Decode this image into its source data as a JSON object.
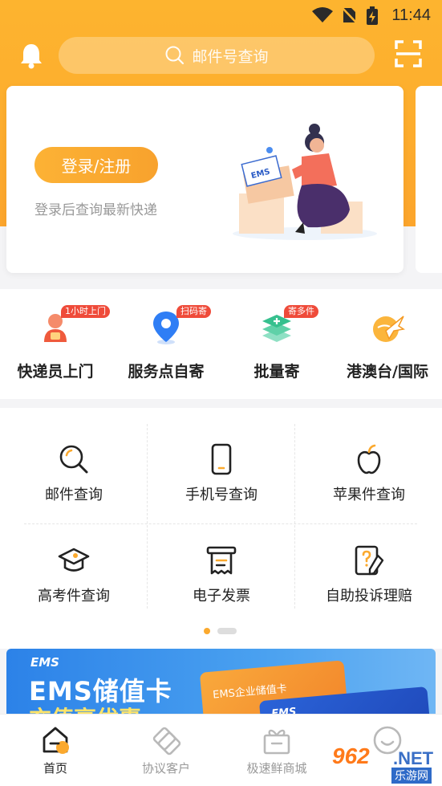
{
  "status_bar": {
    "time": "11:44"
  },
  "header": {
    "search_placeholder": "邮件号查询"
  },
  "login_card": {
    "button_label": "登录/注册",
    "hint": "登录后查询最新快递",
    "illustration_text": "EMS"
  },
  "services": [
    {
      "label": "快递员上门",
      "tag": "1小时上门",
      "icon": "courier-icon"
    },
    {
      "label": "服务点自寄",
      "tag": "扫码寄",
      "icon": "location-pin-icon"
    },
    {
      "label": "批量寄",
      "tag": "寄多件",
      "icon": "layers-icon"
    },
    {
      "label": "港澳台/国际",
      "tag": "",
      "icon": "plane-globe-icon"
    }
  ],
  "query_grid": [
    {
      "label": "邮件查询",
      "icon": "magnifier-icon"
    },
    {
      "label": "手机号查询",
      "icon": "phone-icon"
    },
    {
      "label": "苹果件查询",
      "icon": "apple-icon"
    },
    {
      "label": "高考件查询",
      "icon": "graduation-cap-icon"
    },
    {
      "label": "电子发票",
      "icon": "invoice-icon"
    },
    {
      "label": "自助投诉理赔",
      "icon": "complaint-icon"
    }
  ],
  "banner": {
    "brand": "EMS",
    "title": "EMS储值卡",
    "subtitle": "充值享优惠",
    "card1_text": "EMS企业储值卡",
    "card2_text": "EMS"
  },
  "tabbar": [
    {
      "label": "首页",
      "icon": "home-icon",
      "active": true
    },
    {
      "label": "协议客户",
      "icon": "handshake-icon",
      "active": false
    },
    {
      "label": "极速鲜商城",
      "icon": "gift-box-icon",
      "active": false
    },
    {
      "label": "",
      "icon": "smile-icon",
      "active": false
    }
  ],
  "watermark": {
    "number": "962",
    "suffix": ".NET",
    "cn": "乐游网"
  },
  "colors": {
    "accent": "#fca52c",
    "tag_red": "#ef4b3a",
    "banner_blue": "#2c82e8"
  }
}
